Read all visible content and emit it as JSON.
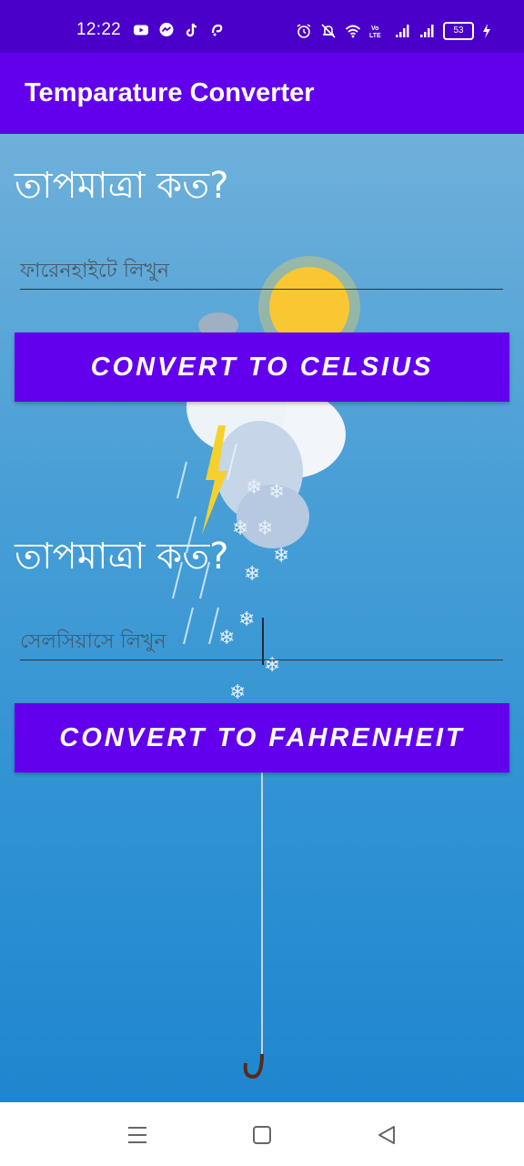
{
  "status_bar": {
    "time": "12:22",
    "battery_level": "53",
    "left_icons": [
      "youtube-icon",
      "messenger-icon",
      "tiktok-icon",
      "notification-icon"
    ],
    "right_icons": [
      "alarm-icon",
      "mute-icon",
      "wifi-icon",
      "volte-icon",
      "signal-icon",
      "signal-icon",
      "battery-icon",
      "charging-icon"
    ]
  },
  "app_bar": {
    "title": "Temparature Converter",
    "color": "#6200ee"
  },
  "celsius_section": {
    "heading": "তাপমাত্রা কত?",
    "input_placeholder": "ফারেনহাইটে লিখুন",
    "input_value": "",
    "button_label": "CONVERT TO CELSIUS"
  },
  "fahrenheit_section": {
    "heading": "তাপমাত্রা কত?",
    "input_placeholder": "সেলসিয়াসে লিখুন",
    "input_value": "",
    "button_label": "CONVERT TO FAHRENHEIT"
  },
  "nav_bar": {
    "buttons": [
      "menu-icon",
      "home-icon",
      "back-icon"
    ]
  }
}
